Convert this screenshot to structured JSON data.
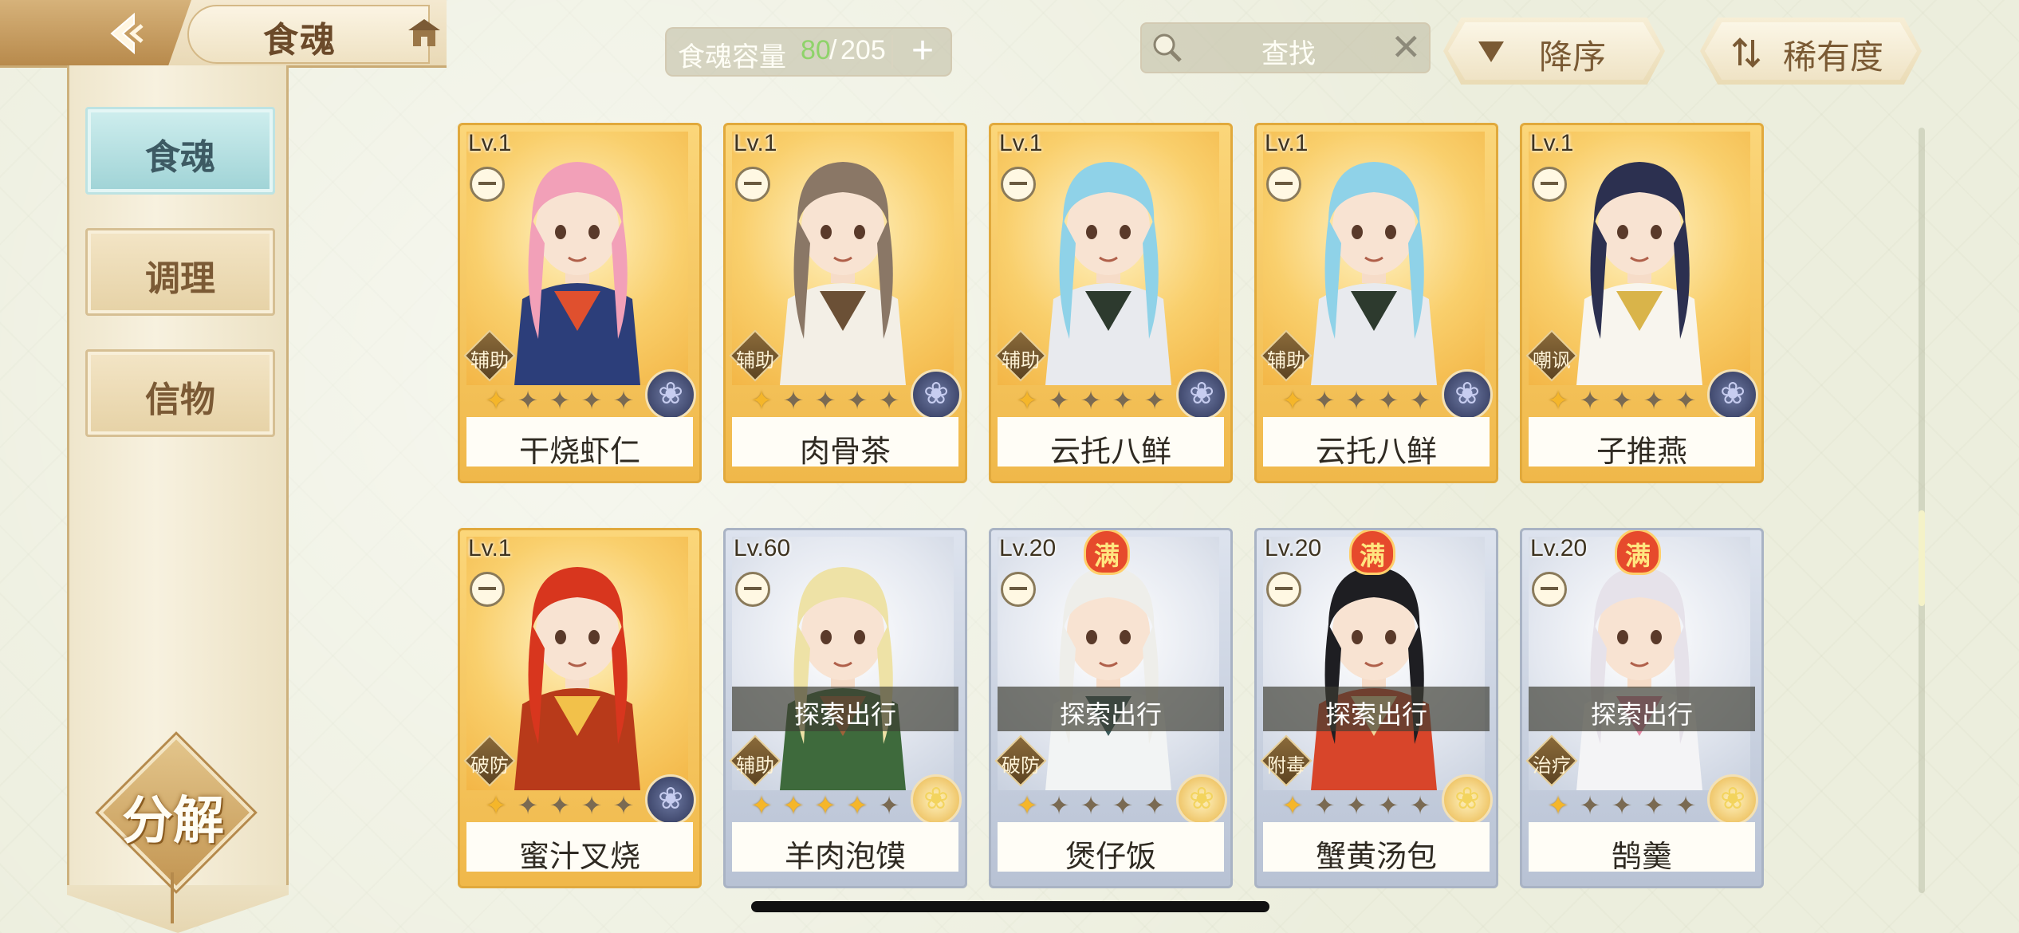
{
  "header": {
    "title": "食魂",
    "capacity": {
      "label": "食魂容量",
      "current": "80",
      "separator": "/",
      "max": "205",
      "add": "+"
    },
    "search": {
      "placeholder": "查找",
      "clear": "✕"
    },
    "sort_order": "降序",
    "sort_key": "稀有度"
  },
  "sidebar": {
    "tabs": [
      {
        "label": "食魂",
        "active": true
      },
      {
        "label": "调理",
        "active": false
      },
      {
        "label": "信物",
        "active": false
      }
    ],
    "decompose": "分解"
  },
  "cards": [
    {
      "level": "Lv.1",
      "name": "干烧虾仁",
      "role": "辅助",
      "rarity": "gold",
      "stars_lit": 1,
      "element": "dark",
      "exploring": false,
      "full": false,
      "art": {
        "hair": "#f2a0b8",
        "outfit": "#2c3e7a",
        "accent": "#e0502e"
      }
    },
    {
      "level": "Lv.1",
      "name": "肉骨茶",
      "role": "辅助",
      "rarity": "gold",
      "stars_lit": 1,
      "element": "dark",
      "exploring": false,
      "full": false,
      "art": {
        "hair": "#8a7766",
        "outfit": "#f3efe6",
        "accent": "#6b5036"
      }
    },
    {
      "level": "Lv.1",
      "name": "云托八鲜",
      "role": "辅助",
      "rarity": "gold",
      "stars_lit": 1,
      "element": "dark",
      "exploring": false,
      "full": false,
      "art": {
        "hair": "#8fd2e8",
        "outfit": "#e8eaee",
        "accent": "#2d3a2e"
      }
    },
    {
      "level": "Lv.1",
      "name": "云托八鲜",
      "role": "辅助",
      "rarity": "gold",
      "stars_lit": 1,
      "element": "dark",
      "exploring": false,
      "full": false,
      "art": {
        "hair": "#8fd2e8",
        "outfit": "#e8eaee",
        "accent": "#2d3a2e"
      }
    },
    {
      "level": "Lv.1",
      "name": "子推燕",
      "role": "嘲讽",
      "rarity": "gold",
      "stars_lit": 1,
      "element": "dark",
      "exploring": false,
      "full": false,
      "art": {
        "hair": "#2c3050",
        "outfit": "#f8f5ee",
        "accent": "#d9b44a"
      }
    },
    {
      "level": "Lv.1",
      "name": "蜜汁叉烧",
      "role": "破防",
      "rarity": "gold",
      "stars_lit": 1,
      "element": "dark",
      "exploring": false,
      "full": false,
      "art": {
        "hair": "#d8361e",
        "outfit": "#b83a1a",
        "accent": "#f2c14a"
      }
    },
    {
      "level": "Lv.60",
      "name": "羊肉泡馍",
      "role": "辅助",
      "rarity": "silver",
      "stars_lit": 4,
      "element": "light",
      "exploring": true,
      "full": false,
      "art": {
        "hair": "#eee2a6",
        "outfit": "#3e6a3c",
        "accent": "#a0633a"
      }
    },
    {
      "level": "Lv.20",
      "name": "煲仔饭",
      "role": "破防",
      "rarity": "silver",
      "stars_lit": 1,
      "element": "light",
      "exploring": true,
      "full": true,
      "art": {
        "hair": "#eeeeea",
        "outfit": "#f2f4f4",
        "accent": "#3a5a5a"
      }
    },
    {
      "level": "Lv.20",
      "name": "蟹黄汤包",
      "role": "附毒",
      "rarity": "silver",
      "stars_lit": 1,
      "element": "light",
      "exploring": true,
      "full": true,
      "art": {
        "hair": "#1e1e22",
        "outfit": "#d8452a",
        "accent": "#f1d79c"
      }
    },
    {
      "level": "Lv.20",
      "name": "鹄羹",
      "role": "治疗",
      "rarity": "silver",
      "stars_lit": 1,
      "element": "light",
      "exploring": true,
      "full": true,
      "art": {
        "hair": "#e6e2ea",
        "outfit": "#f4f4f6",
        "accent": "#e38aa6"
      }
    }
  ],
  "labels": {
    "exploring": "探索出行",
    "full": "满"
  },
  "colors": {
    "accent_teal": "#9fd3d6",
    "gold": "#f0b84a",
    "capacity_current": "#8fd36a"
  }
}
